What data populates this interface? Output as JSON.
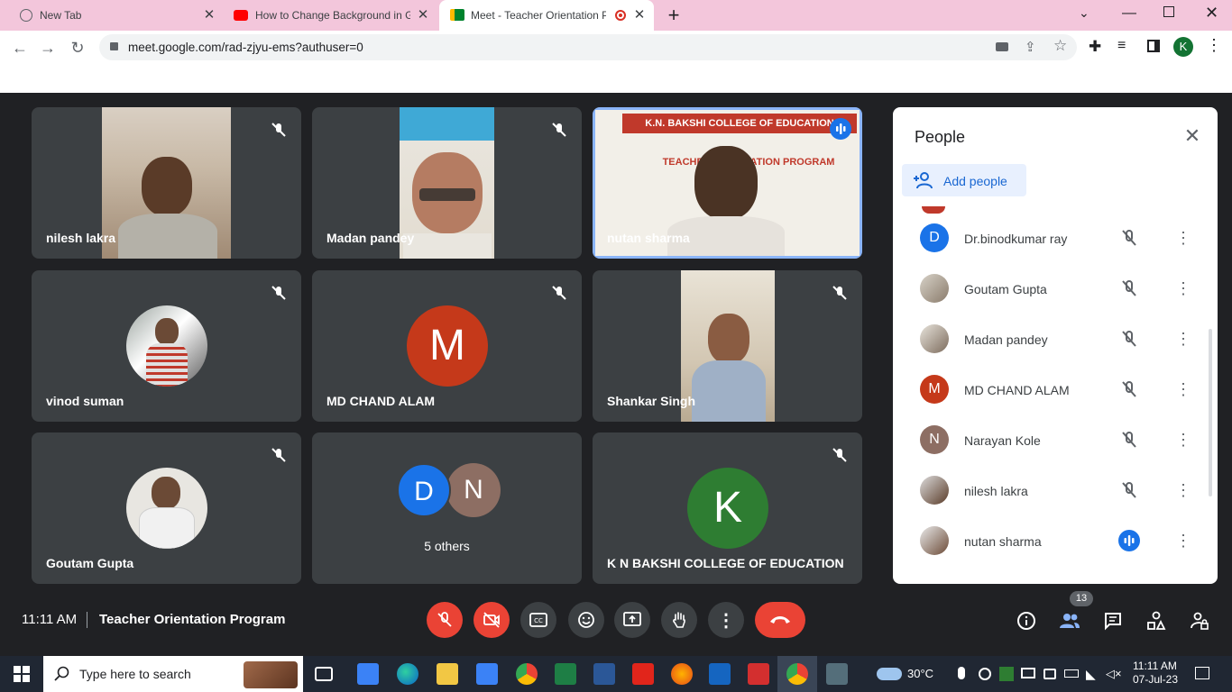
{
  "browser": {
    "tabs": [
      {
        "title": "New Tab"
      },
      {
        "title": "How to Change Background in G"
      },
      {
        "title": "Meet - Teacher Orientation P"
      }
    ],
    "new_tab_label": "+",
    "url": "meet.google.com/rad-zjyu-ems?authuser=0",
    "profile_initial": "K"
  },
  "meet": {
    "tiles": [
      {
        "name": "nilesh lakra"
      },
      {
        "name": "Madan pandey"
      },
      {
        "name": "nutan sharma"
      },
      {
        "name": "vinod suman"
      },
      {
        "name": "MD CHAND ALAM",
        "initial": "M"
      },
      {
        "name": "Shankar Singh"
      },
      {
        "name": "Goutam Gupta"
      },
      {
        "name": "5 others",
        "initials": [
          "D",
          "N"
        ]
      },
      {
        "name": "K N BAKSHI COLLEGE OF EDUCATION",
        "initial": "K"
      }
    ],
    "banner": {
      "line1": "K.N. BAKSHI COLLEGE OF EDUCATION",
      "line2": "TEACHER ORIENTATION PROGRAM"
    }
  },
  "people": {
    "title": "People",
    "add_label": "Add people",
    "list": [
      {
        "name": "Dr.binodkumar ray",
        "initial": "D",
        "color": "#1a73e8"
      },
      {
        "name": "Goutam Gupta",
        "photo": true
      },
      {
        "name": "Madan pandey",
        "photo": true
      },
      {
        "name": "MD CHAND ALAM",
        "initial": "M",
        "color": "#c5391a"
      },
      {
        "name": "Narayan Kole",
        "initial": "N",
        "color": "#8d6e63"
      },
      {
        "name": "nilesh lakra",
        "photo": true
      },
      {
        "name": "nutan sharma",
        "photo": true,
        "speaking": true
      }
    ]
  },
  "controls": {
    "time": "11:11 AM",
    "meeting_title": "Teacher Orientation Program",
    "participants_count": "13"
  },
  "taskbar": {
    "search_placeholder": "Type here to search",
    "temperature": "30°C",
    "time": "11:11 AM",
    "date": "07-Jul-23"
  },
  "colors": {
    "accent": "#8ab4f8",
    "danger": "#ea4335",
    "tab_strip": "#f3c6db"
  }
}
